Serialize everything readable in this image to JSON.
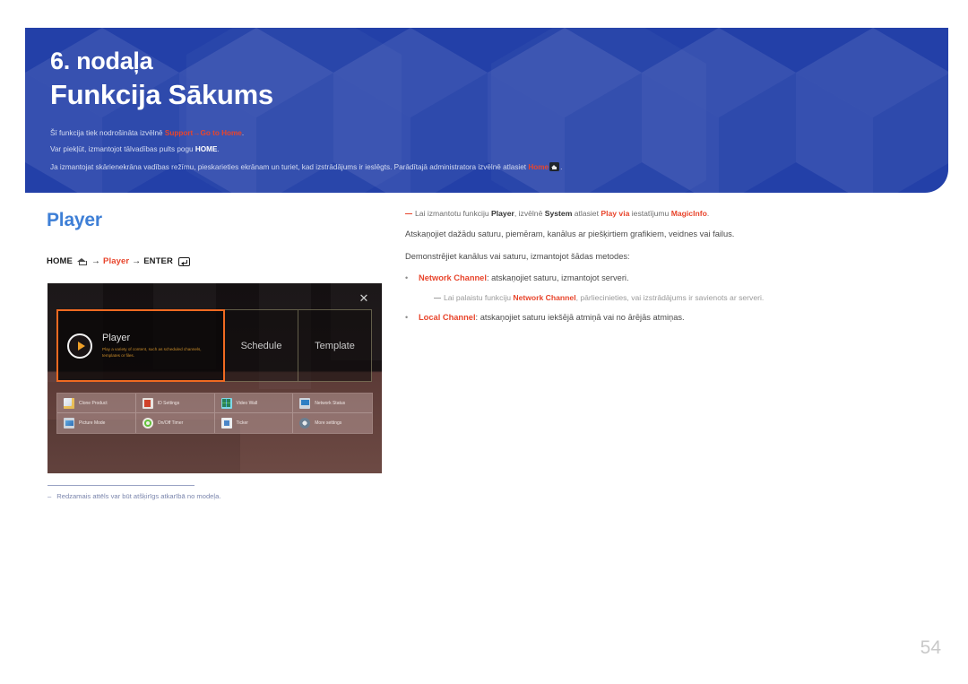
{
  "banner": {
    "chapter_number": "6. nodaļa",
    "chapter_title": "Funkcija Sākums",
    "line1": {
      "pre": "Šī funkcija tiek nodrošināta izvēlnē ",
      "hl1": "Support",
      "arrow": "→",
      "hl2": "Go to Home",
      "post": "."
    },
    "line2": {
      "pre": "Var piekļūt, izmantojot tālvadības pults pogu ",
      "hl": "HOME",
      "post": "."
    },
    "line3": {
      "pre": "Ja izmantojat skārienekrāna vadības režīmu, pieskarieties ekrānam un turiet, kad izstrādājums ir ieslēgts. Parādītajā administratora izvēlnē atlasiet ",
      "hl": "Home",
      "icon": "home-icon",
      "post": "."
    },
    "bg_color": "#2340a8",
    "accent_color": "#e8452c"
  },
  "left": {
    "section_title": "Player",
    "section_title_color": "#3e7fd6",
    "breadcrumb": {
      "home_label": "HOME",
      "home_icon": "home-outline-icon",
      "arrow1": "→",
      "player_label": "Player",
      "arrow2": "→",
      "enter_label": "ENTER",
      "enter_icon": "enter-key-icon"
    },
    "caption": {
      "dash": "–",
      "text": "Redzamais attēls var būt atšķirīgs atkarībā no modeļa."
    }
  },
  "screenshot": {
    "close_icon": "close-icon",
    "tiles": [
      {
        "name": "Player",
        "description": "Play a variety of content, such as scheduled channels, templates or files.",
        "icon": "play-circle-icon",
        "selected": true
      },
      {
        "name": "Schedule",
        "selected": false
      },
      {
        "name": "Template",
        "selected": false
      }
    ],
    "icon_grid": [
      {
        "label": "Clone Product",
        "icon": "clone-product-icon"
      },
      {
        "label": "ID Settings",
        "icon": "id-settings-icon"
      },
      {
        "label": "Video Wall",
        "icon": "video-wall-icon"
      },
      {
        "label": "Network Status",
        "icon": "network-status-icon"
      },
      {
        "label": "Picture Mode",
        "icon": "picture-mode-icon"
      },
      {
        "label": "On/Off Timer",
        "icon": "on-off-timer-icon"
      },
      {
        "label": "Ticker",
        "icon": "ticker-icon"
      },
      {
        "label": "More settings",
        "icon": "more-settings-icon"
      }
    ],
    "selection_color": "#f06a21"
  },
  "right": {
    "note1": {
      "pre": "Lai izmantotu funkciju ",
      "b1": "Player",
      "mid1": ", izvēlnē ",
      "b2": "System",
      "mid2": " atlasiet ",
      "b3": "Play via",
      "mid3": " iestatījumu ",
      "b4": "MagicInfo",
      "post": "."
    },
    "line1": "Atskaņojiet dažādu saturu, piemēram, kanālus ar piešķirtiem grafikiem, veidnes vai failus.",
    "line2": "Demonstrējiet kanālus vai saturu, izmantojot šādas metodes:",
    "bullet1": {
      "term": "Network Channel",
      "text": ": atskaņojiet saturu, izmantojot serveri."
    },
    "subnote1": {
      "pre": "Lai palaistu funkciju ",
      "b": "Network Channel",
      "post": ", pārliecinieties, vai izstrādājums ir savienots ar serveri."
    },
    "bullet2": {
      "term": "Local Channel",
      "text": ": atskaņojiet saturu iekšējā atmiņā vai no ārējās atmiņas."
    }
  },
  "footer": {
    "page_number": "54"
  }
}
